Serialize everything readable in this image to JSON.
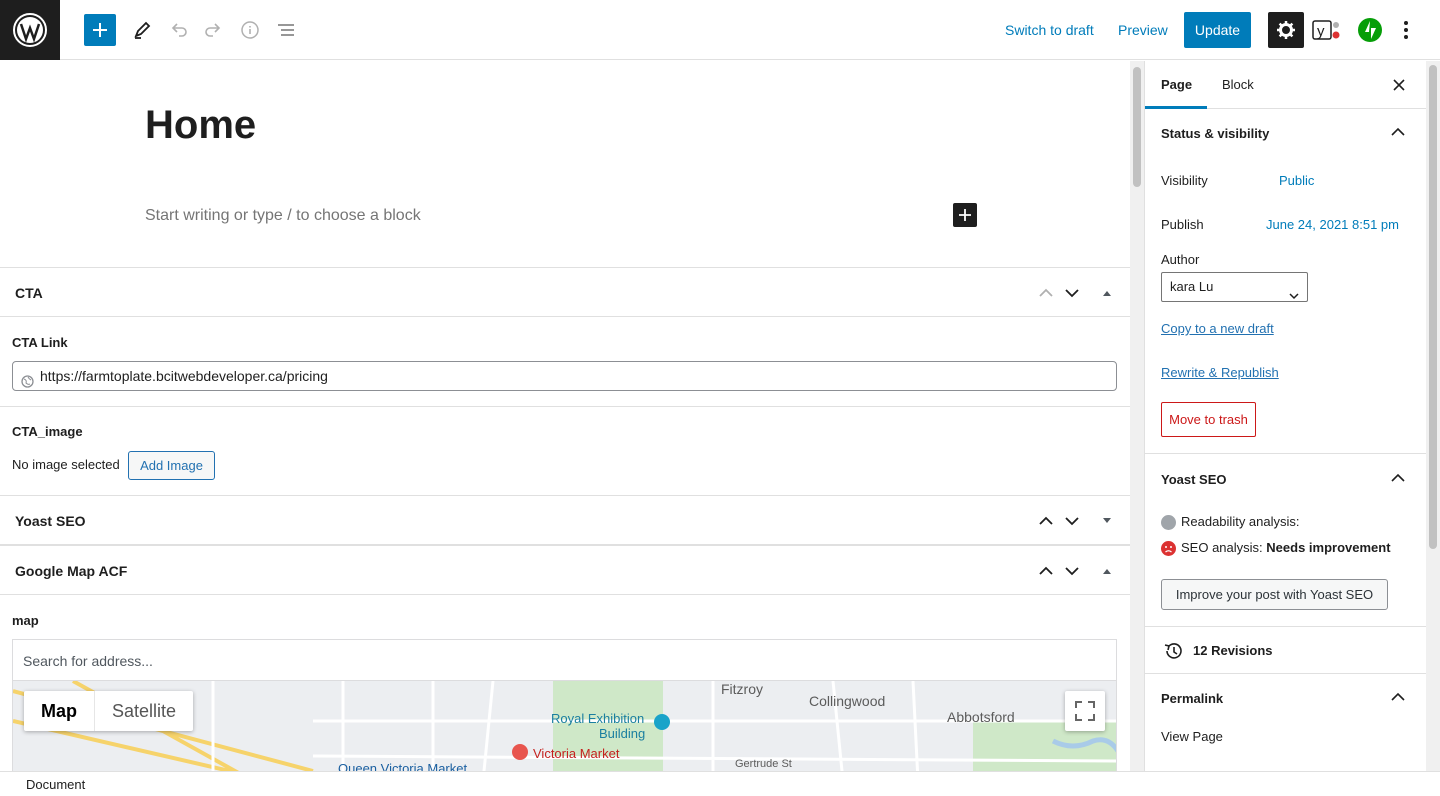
{
  "toolbar": {
    "switch_to_draft": "Switch to draft",
    "preview": "Preview",
    "update": "Update"
  },
  "editor": {
    "title": "Home",
    "placeholder": "Start writing or type / to choose a block"
  },
  "metaboxes": {
    "cta": {
      "title": "CTA",
      "link_label": "CTA Link",
      "link_value": "https://farmtoplate.bcitwebdeveloper.ca/pricing",
      "image_label": "CTA_image",
      "no_image": "No image selected",
      "add_image": "Add Image"
    },
    "yoast": {
      "title": "Yoast SEO"
    },
    "gmap": {
      "title": "Google Map ACF",
      "field_label": "map",
      "search_placeholder": "Search for address...",
      "map_type_map": "Map",
      "map_type_satellite": "Satellite",
      "labels": [
        "Fitzroy",
        "Collingwood",
        "Abbotsford",
        "Royal Exhibition",
        "Building",
        "Victoria Market",
        "Queen Victoria Market",
        "Gertrude St"
      ]
    }
  },
  "sidebar": {
    "tabs": [
      "Page",
      "Block"
    ],
    "status": {
      "title": "Status & visibility",
      "visibility_label": "Visibility",
      "visibility_value": "Public",
      "publish_label": "Publish",
      "publish_value": "June 24, 2021 8:51 pm",
      "author_label": "Author",
      "author_value": "kara Lu",
      "copy_draft": "Copy to a new draft",
      "rewrite": "Rewrite & Republish",
      "trash": "Move to trash"
    },
    "yoast": {
      "title": "Yoast SEO",
      "readability": "Readability analysis:",
      "seo_prefix": "SEO analysis:",
      "seo_value": "Needs improvement",
      "improve": "Improve your post with Yoast SEO"
    },
    "revisions": "12 Revisions",
    "permalink": {
      "title": "Permalink",
      "view_page": "View Page"
    }
  },
  "footer": {
    "breadcrumb": "Document"
  },
  "colors": {
    "accent": "#007cba",
    "danger": "#cc1818",
    "dark": "#1e1e1e"
  }
}
